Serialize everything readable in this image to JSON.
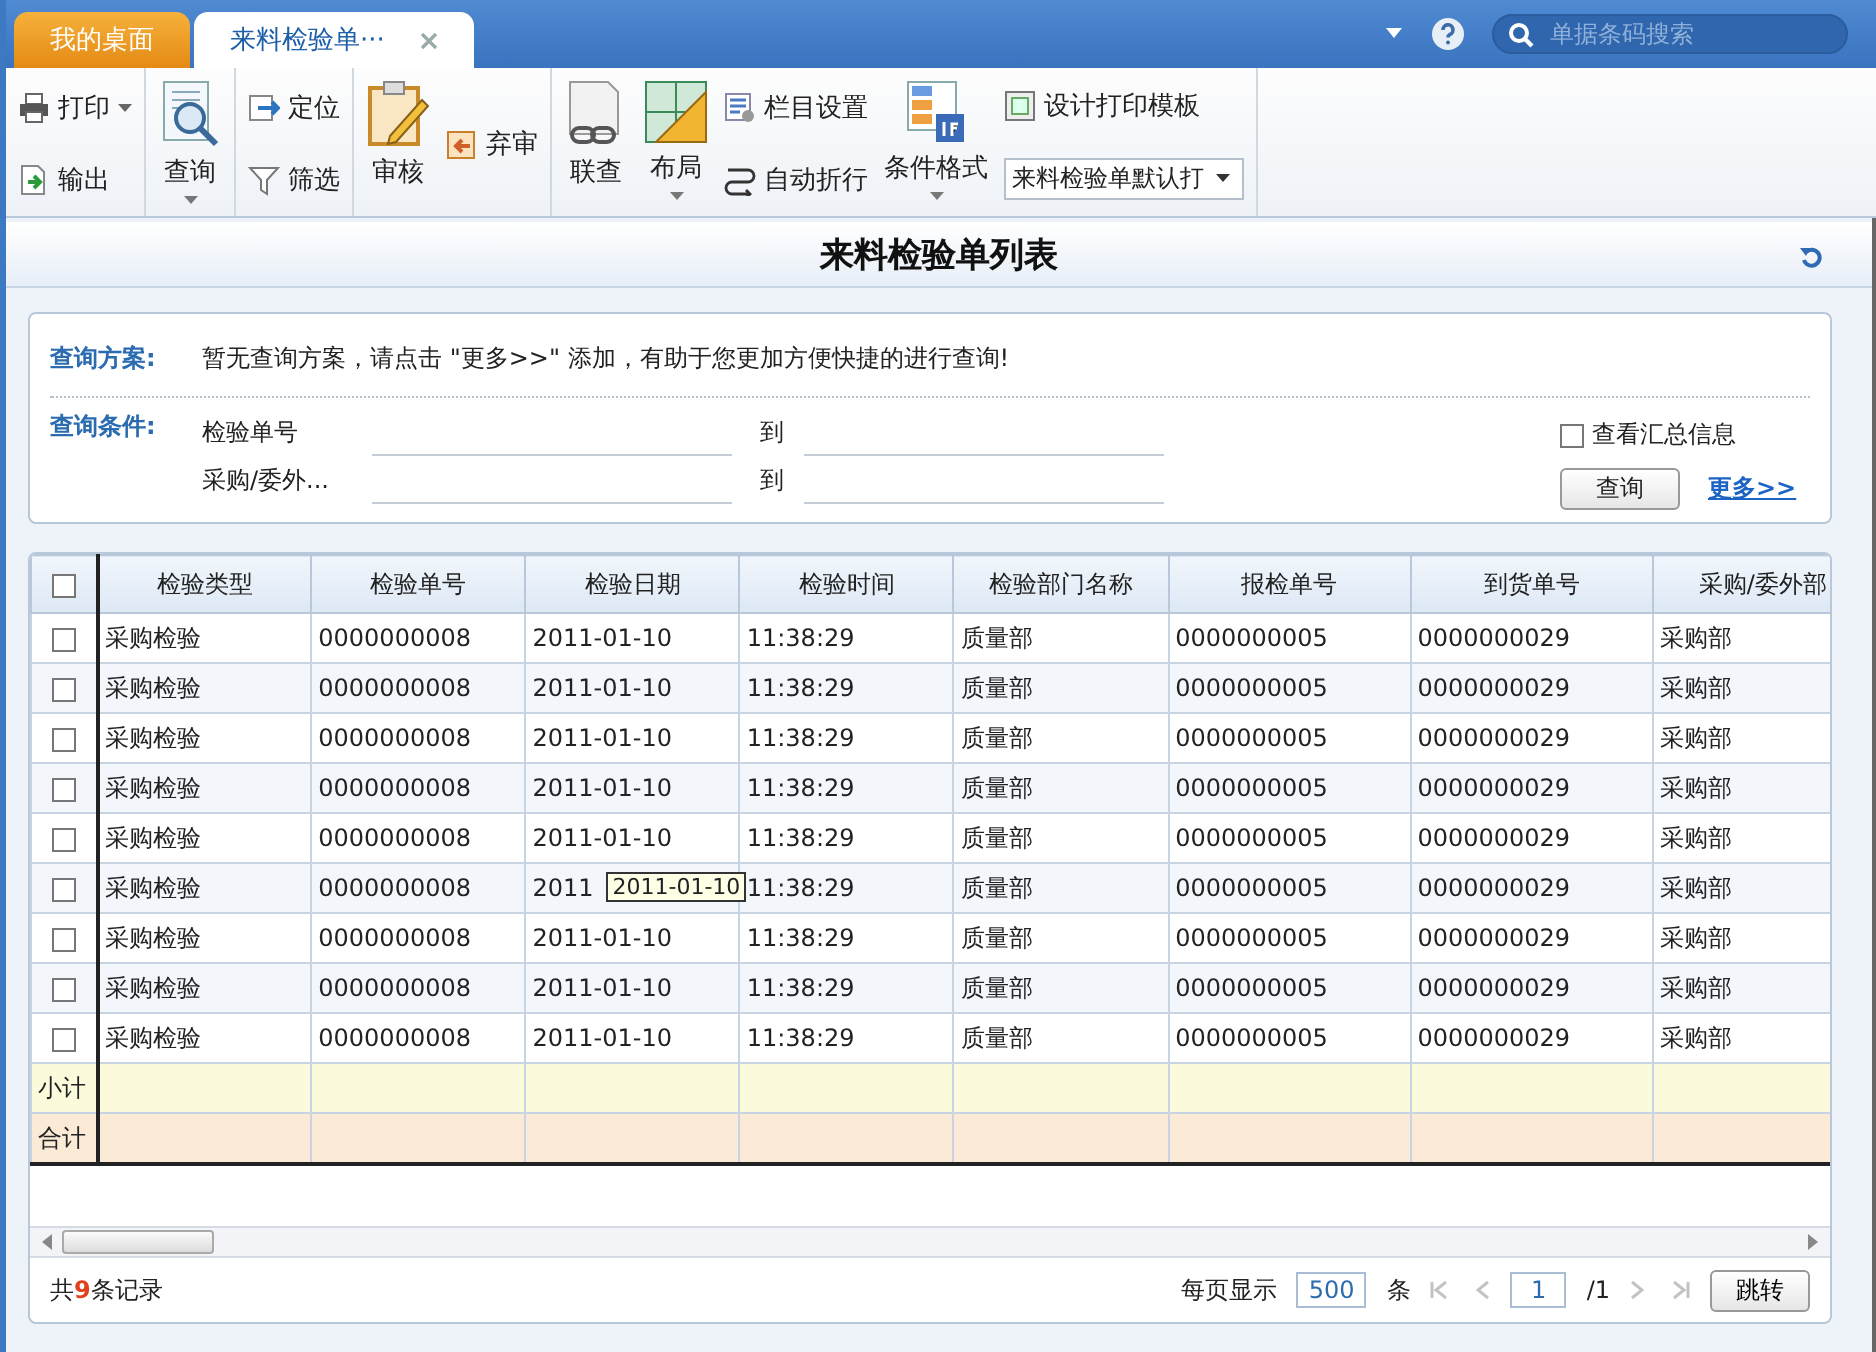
{
  "tabs": [
    {
      "label": "我的桌面",
      "selected": false,
      "closable": false
    },
    {
      "label": "来料检验单···",
      "selected": true,
      "closable": true
    }
  ],
  "search": {
    "placeholder": "单据条码搜索"
  },
  "toolbar": {
    "print": {
      "label": "打印",
      "caret": true
    },
    "export": {
      "label": "输出"
    },
    "query": {
      "label": "查询",
      "caret": true
    },
    "locate": {
      "label": "定位"
    },
    "filter": {
      "label": "筛选"
    },
    "approve": {
      "label": "审核"
    },
    "unapprove": {
      "label": "弃审"
    },
    "link": {
      "label": "联查"
    },
    "layout": {
      "label": "布局",
      "caret": true
    },
    "columns": {
      "label": "栏目设置"
    },
    "wrap": {
      "label": "自动折行"
    },
    "condformat": {
      "label": "条件格式",
      "caret": true
    },
    "design": {
      "label": "设计打印模板"
    },
    "template_select": {
      "value": "来料检验单默认打"
    }
  },
  "page_title": "来料检验单列表",
  "query_panel": {
    "scheme_label": "查询方案:",
    "scheme_message": "暂无查询方案，请点击 \"更多>>\" 添加，有助于您更加方便快捷的进行查询!",
    "conditions_label": "查询条件:",
    "conditions": [
      {
        "label": "检验单号",
        "to": "到"
      },
      {
        "label": "采购/委外...",
        "to": "到"
      }
    ],
    "summary_checkbox": {
      "label": "查看汇总信息",
      "checked": false
    },
    "query_button": "查询",
    "more_link": "更多>>"
  },
  "table": {
    "columns": [
      "检验类型",
      "检验单号",
      "检验日期",
      "检验时间",
      "检验部门名称",
      "报检单号",
      "到货单号",
      "采购/委外部"
    ],
    "rows": [
      {
        "checked": false,
        "cells": [
          "采购检验",
          "0000000008",
          "2011-01-10",
          "11:38:29",
          "质量部",
          "0000000005",
          "0000000029",
          "采购部"
        ]
      },
      {
        "checked": false,
        "cells": [
          "采购检验",
          "0000000008",
          "2011-01-10",
          "11:38:29",
          "质量部",
          "0000000005",
          "0000000029",
          "采购部"
        ]
      },
      {
        "checked": false,
        "cells": [
          "采购检验",
          "0000000008",
          "2011-01-10",
          "11:38:29",
          "质量部",
          "0000000005",
          "0000000029",
          "采购部"
        ]
      },
      {
        "checked": false,
        "cells": [
          "采购检验",
          "0000000008",
          "2011-01-10",
          "11:38:29",
          "质量部",
          "0000000005",
          "0000000029",
          "采购部"
        ]
      },
      {
        "checked": false,
        "cells": [
          "采购检验",
          "0000000008",
          "2011-01-10",
          "11:38:29",
          "质量部",
          "0000000005",
          "0000000029",
          "采购部"
        ]
      },
      {
        "checked": false,
        "cells": [
          "采购检验",
          "0000000008",
          "2011",
          "11:38:29",
          "质量部",
          "0000000005",
          "0000000029",
          "采购部"
        ],
        "date_tooltip": "2011-01-10"
      },
      {
        "checked": false,
        "cells": [
          "采购检验",
          "0000000008",
          "2011-01-10",
          "11:38:29",
          "质量部",
          "0000000005",
          "0000000029",
          "采购部"
        ]
      },
      {
        "checked": false,
        "cells": [
          "采购检验",
          "0000000008",
          "2011-01-10",
          "11:38:29",
          "质量部",
          "0000000005",
          "0000000029",
          "采购部"
        ]
      },
      {
        "checked": false,
        "cells": [
          "采购检验",
          "0000000008",
          "2011-01-10",
          "11:38:29",
          "质量部",
          "0000000005",
          "0000000029",
          "采购部"
        ]
      }
    ],
    "summary_rows": [
      {
        "kind": "subtotal",
        "label": "小计"
      },
      {
        "kind": "total",
        "label": "合计"
      }
    ],
    "header_checked": false
  },
  "footer": {
    "record_count": "共**9**条记录",
    "per_page_label": "每页显示",
    "per_page": "500",
    "per_page_unit": "条",
    "page": "1",
    "page_total": "/1",
    "nav_disabled": true,
    "jump_button": "跳转"
  }
}
